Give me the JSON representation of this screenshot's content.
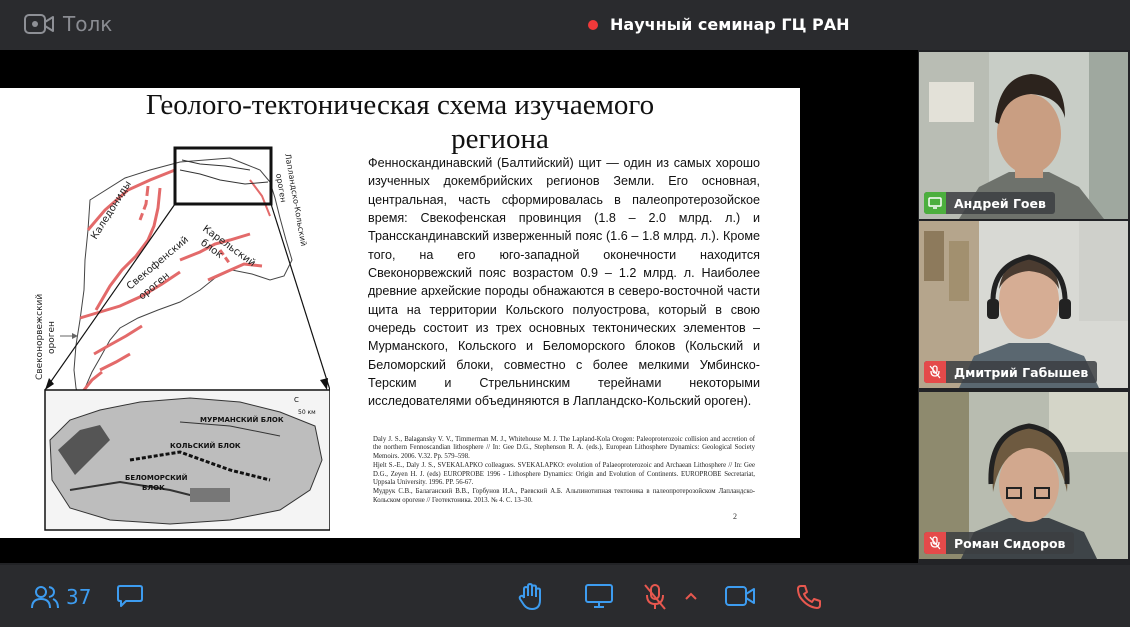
{
  "app": {
    "name": "Толк"
  },
  "meeting": {
    "title": "Научный семинар ГЦ РАН"
  },
  "slide": {
    "title_line1": "Геолого-тектоническая схема изучаемого",
    "title_line2": "региона",
    "body": "Фенноскандинавский (Балтийский) щит — один из самых хорошо изученных докембрийских регионов Земли. Его основная, центральная, часть сформировалась в палеопротерозойское время: Свекофенская провинция (1.8 – 2.0 млрд. л.) и Трансскандинавский изверженный пояс (1.6 – 1.8 млрд. л.). Кроме того, на его юго-западной оконечности находится Свеконорвежский пояс возрастом 0.9 – 1.2 млрд. л. Наиболее древние архейские породы обнажаются в северо-восточной части щита на территории Кольского полуострова, который в свою очередь состоит из трех основных тектонических элементов – Мурманского, Кольского и Беломорского блоков (Кольский и Беломорский блоки, совместно с более мелкими Умбинско-Терским и Стрельнинским терейнами некоторыми исследователями объединяются в Лапландско-Кольский ороген).",
    "refs": [
      "Daly J. S., Balagansky V. V., Timmerman M. J., Whitehouse M. J. The Lapland-Kola Orogen: Paleoproterozoic collision and accretion of the northern Fennoscandian lithosphere // In: Gee D.G., Stephenson R. A. (eds.), European Lithosphere Dynamics: Geological Society Memoirs. 2006. V.32. Pp. 579–598.",
      "Hjelt S.-E., Daly J. S., SVEKALAPKO colleagues. SVEKALAPKO: evolution of Palaeoproterozoic and Archaean Lithosphere // In: Gee D.G., Zeyen H. J. (eds) EUROPROBE 1996 - Lithosphere Dynamics: Origin and Evolution of Continents. EUROPROBE Secretariat, Uppsala University. 1996. PP. 56-67.",
      "Мудрук С.В., Балаганский В.В., Горбунов И.А., Раевский А.Б. Альпинотипная тектоника в палеопротерозойском Лапландско-Кольском орогене // Геотектоника. 2013. № 4. С. 13–30."
    ],
    "page": "2",
    "map_labels": {
      "caledonides": "Каледониды",
      "svecofennian": "Свекофенский",
      "orogen": "ороген",
      "karelian": "Карельский",
      "block": "блок",
      "svekonorwegian": "Свеконорвежский",
      "lapland_kola": "Лапландско-Кольский",
      "murmansk": "МУРМАНСКИЙ БЛОК",
      "kola": "КОЛЬСКИЙ БЛОК",
      "belomorsky": "БЕЛОМОРСКИЙ",
      "blok": "БЛОК",
      "scale": "50 км",
      "north": "С"
    }
  },
  "participants": [
    {
      "name": "Андрей Гоев",
      "mic": "on",
      "active": true
    },
    {
      "name": "Дмитрий Габышев",
      "mic": "muted",
      "active": false
    },
    {
      "name": "Роман Сидоров",
      "mic": "muted",
      "active": false
    }
  ],
  "toolbar": {
    "participants_count": "37"
  },
  "colors": {
    "accent": "#3d9cf0",
    "recording": "#f0393a",
    "muted": "#e44a4a",
    "mic_on": "#4caf3e",
    "hangup": "#e8584f"
  },
  "icons": [
    "video-logo-icon",
    "participants-icon",
    "chat-icon",
    "raise-hand-icon",
    "screen-share-icon",
    "mic-muted-icon",
    "chevron-up-icon",
    "camera-icon",
    "hangup-icon"
  ]
}
